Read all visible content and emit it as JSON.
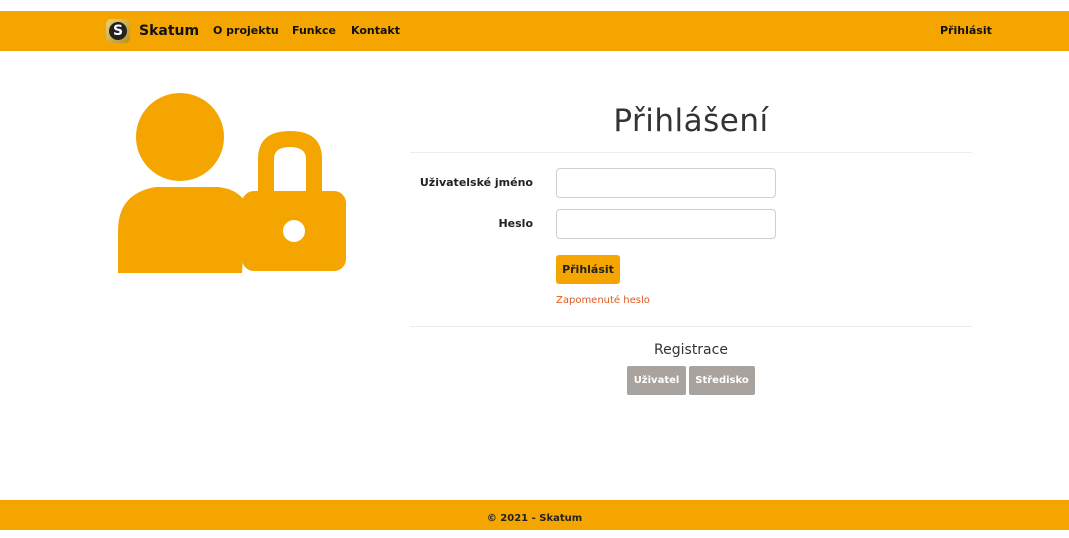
{
  "navbar": {
    "logo_letter": "S",
    "brand": "Skatum",
    "links": [
      "O projektu",
      "Funkce",
      "Kontakt"
    ],
    "login_link": "Přihlásit",
    "color": "#f5a500"
  },
  "hero_icon": "user-lock-icon",
  "login_form": {
    "title": "Přihlášení",
    "username_label": "Uživatelské jméno",
    "username_value": "",
    "password_label": "Heslo",
    "password_value": "",
    "submit_label": "Přihlásit",
    "forgot_link": "Zapomenuté heslo"
  },
  "registration": {
    "title": "Registrace",
    "buttons": [
      "Uživatel",
      "Středisko"
    ]
  },
  "footer": {
    "text": "© 2021 - Skatum"
  }
}
